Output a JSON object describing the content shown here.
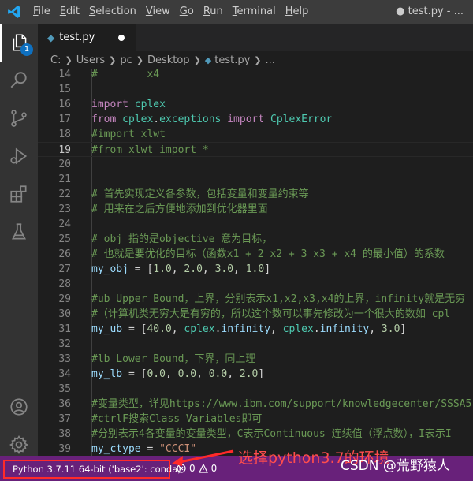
{
  "titlebar": {
    "menu": [
      {
        "label": "File",
        "underline_index": 0
      },
      {
        "label": "Edit",
        "underline_index": 0
      },
      {
        "label": "Selection",
        "underline_index": 0
      },
      {
        "label": "View",
        "underline_index": 0
      },
      {
        "label": "Go",
        "underline_index": 0
      },
      {
        "label": "Run",
        "underline_index": 0
      },
      {
        "label": "Terminal",
        "underline_index": 0
      },
      {
        "label": "Help",
        "underline_index": 0
      }
    ],
    "window_title": "● test.py - ..."
  },
  "activity_bar": {
    "explorer_badge": "1",
    "icons": [
      "explorer-icon",
      "search-icon",
      "source-control-icon",
      "run-debug-icon",
      "extensions-icon",
      "testing-icon",
      "account-icon",
      "settings-gear-icon"
    ]
  },
  "tabs": [
    {
      "label": "test.py",
      "modified": true
    }
  ],
  "breadcrumb": [
    "C:",
    "Users",
    "pc",
    "Desktop",
    "test.py",
    "..."
  ],
  "editor": {
    "current_line": 19,
    "lines": [
      {
        "n": "14",
        "tokens": [
          [
            "c-comment",
            "#        x4"
          ]
        ]
      },
      {
        "n": "15",
        "tokens": []
      },
      {
        "n": "16",
        "tokens": [
          [
            "c-kw",
            "import"
          ],
          [
            "c-plain",
            " "
          ],
          [
            "c-mod",
            "cplex"
          ]
        ]
      },
      {
        "n": "17",
        "tokens": [
          [
            "c-kw",
            "from"
          ],
          [
            "c-plain",
            " "
          ],
          [
            "c-mod",
            "cplex"
          ],
          [
            "c-plain",
            "."
          ],
          [
            "c-mod",
            "exceptions"
          ],
          [
            "c-plain",
            " "
          ],
          [
            "c-kw",
            "import"
          ],
          [
            "c-plain",
            " "
          ],
          [
            "c-mod",
            "CplexError"
          ]
        ]
      },
      {
        "n": "18",
        "tokens": [
          [
            "c-comment",
            "#import xlwt"
          ]
        ]
      },
      {
        "n": "19",
        "tokens": [
          [
            "c-comment",
            "#from xlwt import *"
          ]
        ]
      },
      {
        "n": "20",
        "tokens": []
      },
      {
        "n": "21",
        "tokens": []
      },
      {
        "n": "22",
        "tokens": [
          [
            "c-comment",
            "# 首先实现定义各参数，包括变量和变量约束等"
          ]
        ]
      },
      {
        "n": "23",
        "tokens": [
          [
            "c-comment",
            "# 用来在之后方便地添加到优化器里面"
          ]
        ]
      },
      {
        "n": "24",
        "tokens": []
      },
      {
        "n": "25",
        "tokens": [
          [
            "c-comment",
            "# obj 指的是objective 意为目标，"
          ]
        ]
      },
      {
        "n": "26",
        "tokens": [
          [
            "c-comment",
            "# 也就是要优化的目标（函数x1 + 2 x2 + 3 x3 + x4 的最小值）的系数"
          ]
        ]
      },
      {
        "n": "27",
        "tokens": [
          [
            "c-var",
            "my_obj"
          ],
          [
            "c-plain",
            " = ["
          ],
          [
            "c-num",
            "1.0"
          ],
          [
            "c-plain",
            ", "
          ],
          [
            "c-num",
            "2.0"
          ],
          [
            "c-plain",
            ", "
          ],
          [
            "c-num",
            "3.0"
          ],
          [
            "c-plain",
            ", "
          ],
          [
            "c-num",
            "1.0"
          ],
          [
            "c-plain",
            "]"
          ]
        ]
      },
      {
        "n": "28",
        "tokens": []
      },
      {
        "n": "29",
        "tokens": [
          [
            "c-comment",
            "#ub Upper Bound，上界，分别表示x1,x2,x3,x4的上界，infinity就是无穷"
          ]
        ]
      },
      {
        "n": "30",
        "tokens": [
          [
            "c-comment",
            "#（计算机类无穷大是有穷的，所以这个数可以事先修改为一个很大的数如 cpl"
          ]
        ]
      },
      {
        "n": "31",
        "tokens": [
          [
            "c-var",
            "my_ub"
          ],
          [
            "c-plain",
            " = ["
          ],
          [
            "c-num",
            "40.0"
          ],
          [
            "c-plain",
            ", "
          ],
          [
            "c-mod",
            "cplex"
          ],
          [
            "c-plain",
            "."
          ],
          [
            "c-var",
            "infinity"
          ],
          [
            "c-plain",
            ", "
          ],
          [
            "c-mod",
            "cplex"
          ],
          [
            "c-plain",
            "."
          ],
          [
            "c-var",
            "infinity"
          ],
          [
            "c-plain",
            ", "
          ],
          [
            "c-num",
            "3.0"
          ],
          [
            "c-plain",
            "]"
          ]
        ]
      },
      {
        "n": "32",
        "tokens": []
      },
      {
        "n": "33",
        "tokens": [
          [
            "c-comment",
            "#lb Lower Bound，下界，同上理"
          ]
        ]
      },
      {
        "n": "34",
        "tokens": [
          [
            "c-var",
            "my_lb"
          ],
          [
            "c-plain",
            " = ["
          ],
          [
            "c-num",
            "0.0"
          ],
          [
            "c-plain",
            ", "
          ],
          [
            "c-num",
            "0.0"
          ],
          [
            "c-plain",
            ", "
          ],
          [
            "c-num",
            "0.0"
          ],
          [
            "c-plain",
            ", "
          ],
          [
            "c-num",
            "2.0"
          ],
          [
            "c-plain",
            "]"
          ]
        ]
      },
      {
        "n": "35",
        "tokens": []
      },
      {
        "n": "36",
        "tokens": [
          [
            "c-comment",
            "#变量类型，详见"
          ],
          [
            "c-link",
            "https://www.ibm.com/support/knowledgecenter/SSSA5"
          ]
        ]
      },
      {
        "n": "37",
        "tokens": [
          [
            "c-comment",
            "#ctrlF搜索Class Variables即可"
          ]
        ]
      },
      {
        "n": "38",
        "tokens": [
          [
            "c-comment",
            "#分别表示4各变量的变量类型，C表示Continuous 连续值（浮点数），I表示I"
          ]
        ]
      },
      {
        "n": "39",
        "tokens": [
          [
            "c-var",
            "my_ctype"
          ],
          [
            "c-plain",
            " = "
          ],
          [
            "c-str",
            "\"CCCI\""
          ]
        ]
      }
    ]
  },
  "statusbar": {
    "interpreter": "Python 3.7.11 64-bit ('base2': conda)",
    "errors": "0",
    "warnings": "0"
  },
  "annotation": "选择python3.7的环境",
  "watermark": "CSDN @荒野猿人",
  "colors": {
    "statusbar": "#68217a",
    "highlight": "#ff2a2a",
    "accent": "#0e70c0"
  }
}
